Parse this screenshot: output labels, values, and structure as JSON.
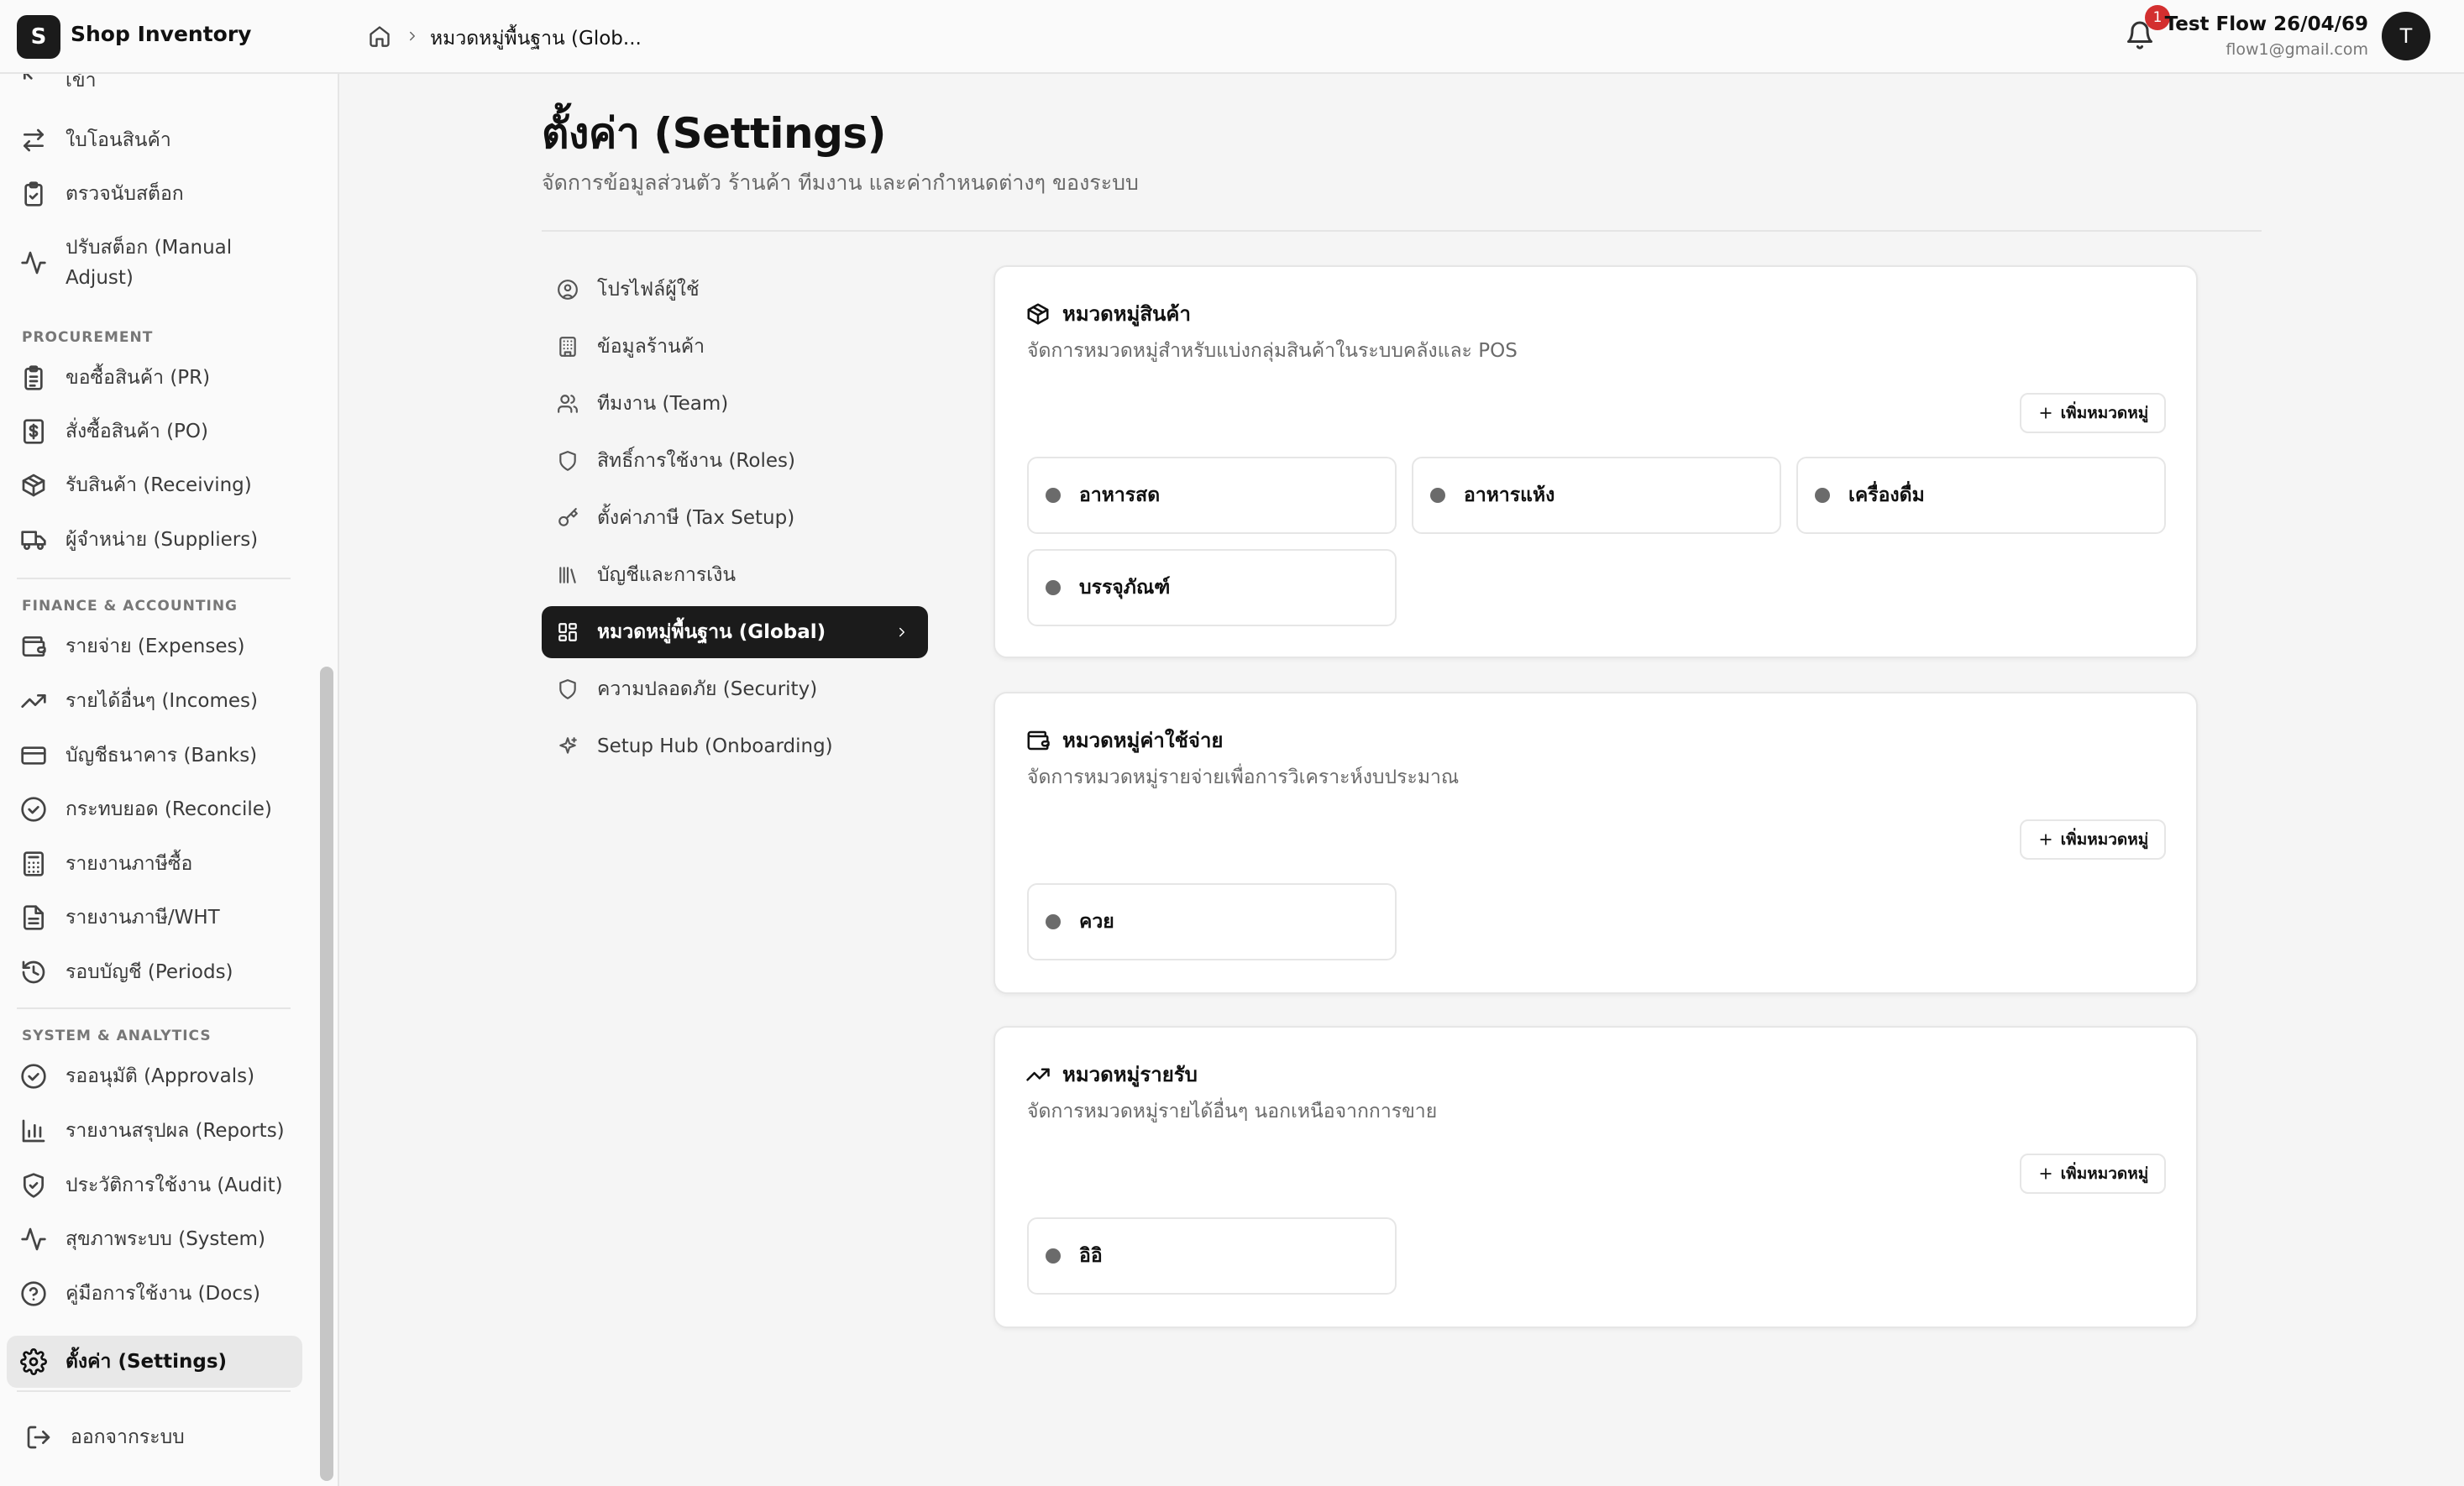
{
  "app": {
    "logo_letter": "S",
    "name": "Shop Inventory"
  },
  "header": {
    "breadcrumb": "หมวดหมู่พื้นฐาน (Glob...",
    "notification_count": "1",
    "user_name": "Test Flow 26/04/69",
    "user_email": "flow1@gmail.com",
    "avatar_letter": "T"
  },
  "sidebar": {
    "items": [
      {
        "label": "เข้า",
        "icon": "arrow-in-icon"
      },
      {
        "label": "ใบโอนสินค้า",
        "icon": "transfer-icon"
      },
      {
        "label": "ตรวจนับสต็อก",
        "icon": "clipboard-check-icon"
      },
      {
        "label": "ปรับสต็อก (Manual Adjust)",
        "icon": "activity-icon"
      },
      {
        "label": "ขอซื้อสินค้า (PR)",
        "icon": "clipboard-list-icon"
      },
      {
        "label": "สั่งซื้อสินค้า (PO)",
        "icon": "dollar-file-icon"
      },
      {
        "label": "รับสินค้า (Receiving)",
        "icon": "package-icon"
      },
      {
        "label": "ผู้จำหน่าย (Suppliers)",
        "icon": "truck-icon"
      },
      {
        "label": "รายจ่าย (Expenses)",
        "icon": "wallet-icon"
      },
      {
        "label": "รายได้อื่นๆ (Incomes)",
        "icon": "trending-up-icon"
      },
      {
        "label": "บัญชีธนาคาร (Banks)",
        "icon": "credit-card-icon"
      },
      {
        "label": "กระทบยอด (Reconcile)",
        "icon": "check-circle-icon"
      },
      {
        "label": "รายงานภาษีซื้อ",
        "icon": "calculator-icon"
      },
      {
        "label": "รายงานภาษี/WHT",
        "icon": "file-text-icon"
      },
      {
        "label": "รอบบัญชี (Periods)",
        "icon": "history-icon"
      },
      {
        "label": "รออนุมัติ (Approvals)",
        "icon": "check-circle-icon"
      },
      {
        "label": "รายงานสรุปผล (Reports)",
        "icon": "bar-chart-icon"
      },
      {
        "label": "ประวัติการใช้งาน (Audit)",
        "icon": "shield-check-icon"
      },
      {
        "label": "สุขภาพระบบ (System)",
        "icon": "activity-icon"
      },
      {
        "label": "คู่มือการใช้งาน (Docs)",
        "icon": "help-circle-icon"
      },
      {
        "label": "ตั้งค่า (Settings)",
        "icon": "gear-icon"
      }
    ],
    "sections": [
      "PROCUREMENT",
      "FINANCE & ACCOUNTING",
      "SYSTEM & ANALYTICS"
    ],
    "logout": "ออกจากระบบ"
  },
  "page": {
    "title": "ตั้งค่า (Settings)",
    "description": "จัดการข้อมูลส่วนตัว ร้านค้า ทีมงาน และค่ากำหนดต่างๆ ของระบบ"
  },
  "settings_nav": [
    {
      "label": "โปรไฟล์ผู้ใช้",
      "icon": "user-circle-icon"
    },
    {
      "label": "ข้อมูลร้านค้า",
      "icon": "building-icon"
    },
    {
      "label": "ทีมงาน (Team)",
      "icon": "users-icon"
    },
    {
      "label": "สิทธิ์การใช้งาน (Roles)",
      "icon": "shield-icon"
    },
    {
      "label": "ตั้งค่าภาษี (Tax Setup)",
      "icon": "key-icon"
    },
    {
      "label": "บัญชีและการเงิน",
      "icon": "library-icon"
    },
    {
      "label": "หมวดหมู่พื้นฐาน (Global)",
      "icon": "grid-icon"
    },
    {
      "label": "ความปลอดภัย (Security)",
      "icon": "shield-icon"
    },
    {
      "label": "Setup Hub (Onboarding)",
      "icon": "sparkles-icon"
    }
  ],
  "cards": [
    {
      "title": "หมวดหมู่สินค้า",
      "icon": "package-icon",
      "description": "จัดการหมวดหมู่สำหรับแบ่งกลุ่มสินค้าในระบบคลังและ POS",
      "add_label": "เพิ่มหมวดหมู่",
      "categories": [
        "อาหารสด",
        "อาหารแห้ง",
        "เครื่องดื่ม",
        "บรรจุภัณฑ์"
      ]
    },
    {
      "title": "หมวดหมู่ค่าใช้จ่าย",
      "icon": "wallet-icon",
      "description": "จัดการหมวดหมู่รายจ่ายเพื่อการวิเคราะห์งบประมาณ",
      "add_label": "เพิ่มหมวดหมู่",
      "categories": [
        "ควย"
      ]
    },
    {
      "title": "หมวดหมู่รายรับ",
      "icon": "trending-up-icon",
      "description": "จัดการหมวดหมู่รายได้อื่นๆ นอกเหนือจากการขาย",
      "add_label": "เพิ่มหมวดหมู่",
      "categories": [
        "อิอิ"
      ]
    }
  ]
}
